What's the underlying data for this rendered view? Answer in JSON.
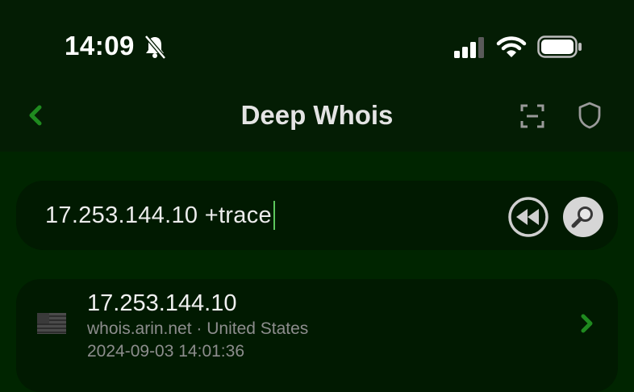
{
  "status": {
    "time": "14:09",
    "icons": [
      "bell-slash-icon",
      "cellular-signal-icon",
      "wifi-icon",
      "battery-icon"
    ]
  },
  "nav": {
    "title": "Deep Whois",
    "back_icon": "chevron-left-icon",
    "actions": [
      "scan-icon",
      "shield-icon"
    ]
  },
  "search": {
    "value": "17.253.144.10 +trace",
    "buttons": [
      "rewind-icon",
      "search-icon"
    ]
  },
  "results": [
    {
      "flag_icon": "us-flag-icon",
      "ip": "17.253.144.10",
      "subtitle": "whois.arin.net · United States",
      "timestamp": "2024-09-03 14:01:36"
    }
  ],
  "colors": {
    "background": "#002500",
    "header": "#041d04",
    "surface": "#011a01",
    "accent": "#1f8a1f"
  }
}
